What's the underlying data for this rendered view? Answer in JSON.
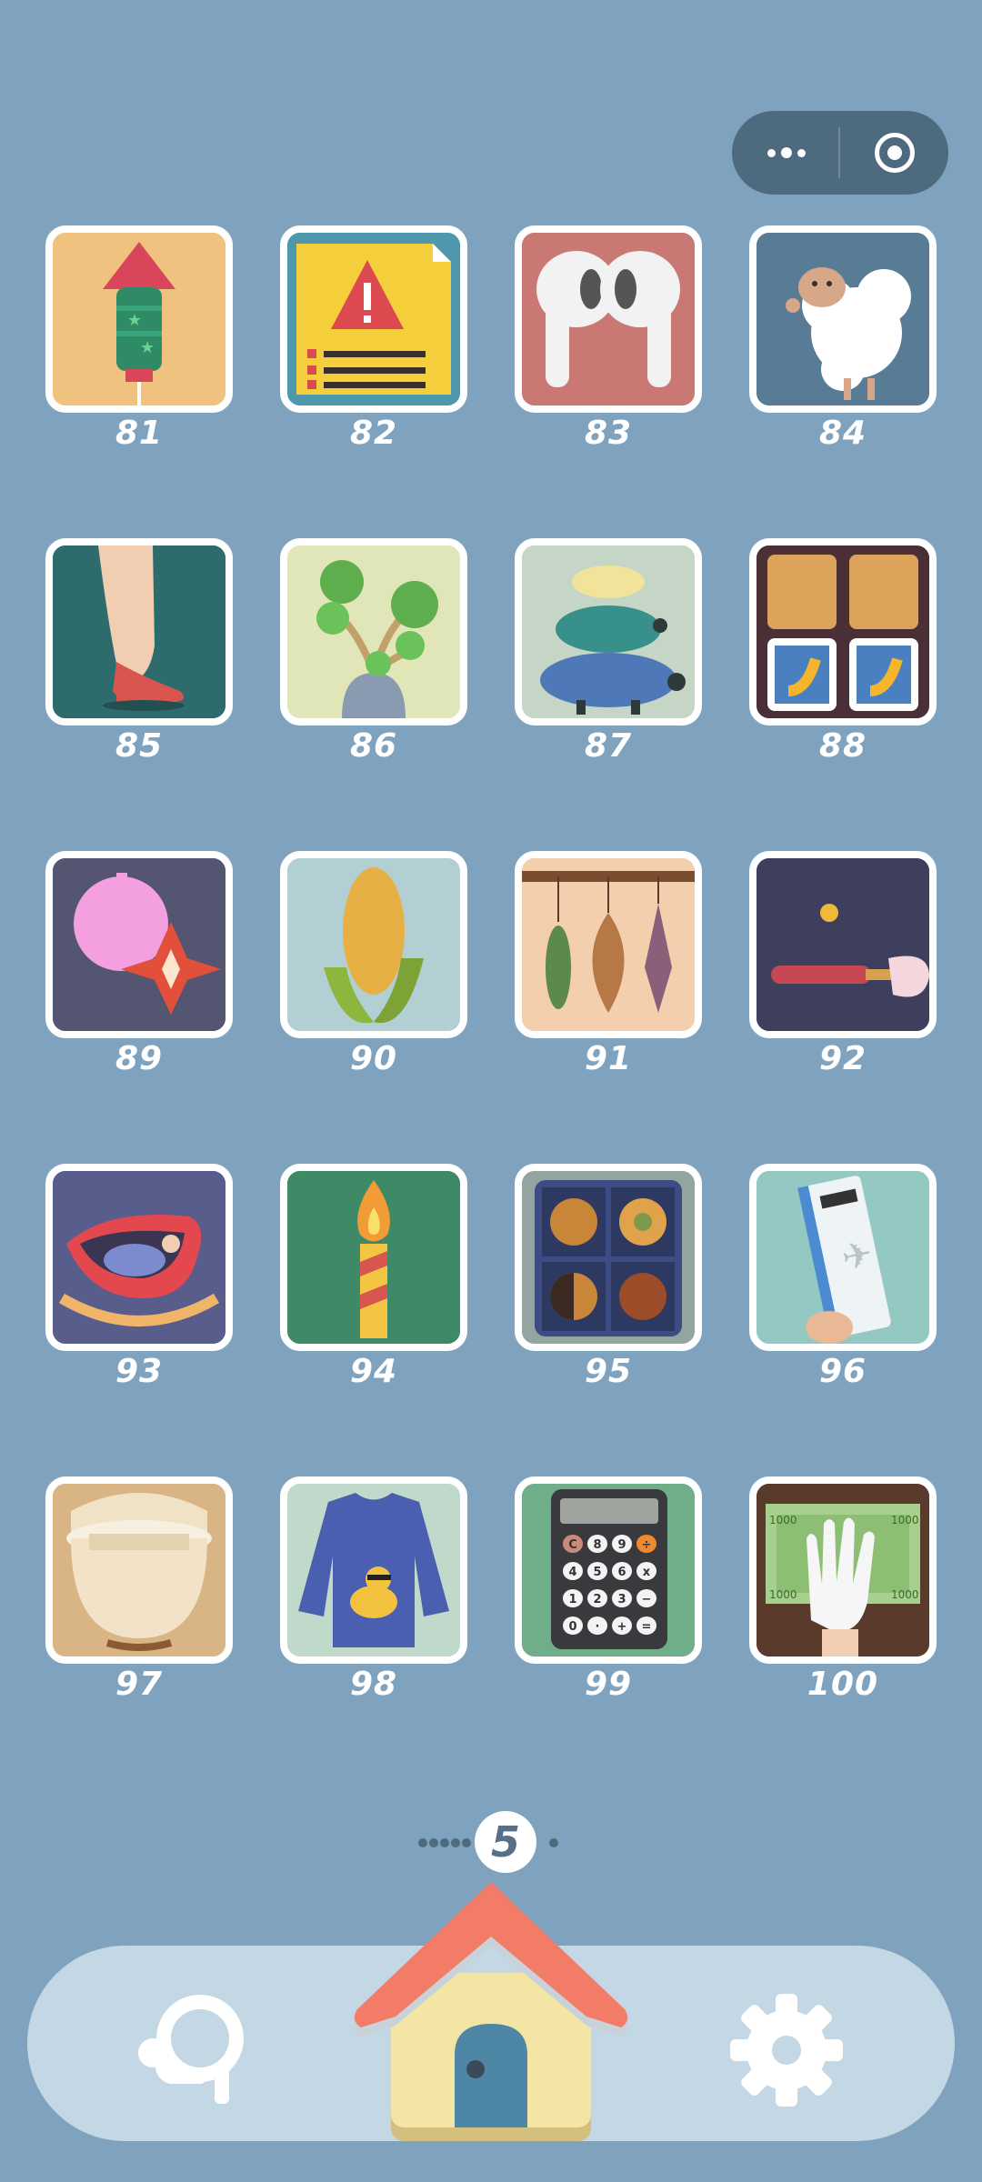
{
  "capsule": {
    "more_icon": "more-dots-icon",
    "close_icon": "target-circle-icon"
  },
  "levels": [
    {
      "number": "81",
      "icon": "firework-rocket"
    },
    {
      "number": "82",
      "icon": "warning-document"
    },
    {
      "number": "83",
      "icon": "earbuds"
    },
    {
      "number": "84",
      "icon": "sheep"
    },
    {
      "number": "85",
      "icon": "red-high-heel"
    },
    {
      "number": "86",
      "icon": "succulent-plant"
    },
    {
      "number": "87",
      "icon": "stacked-turtles"
    },
    {
      "number": "88",
      "icon": "banana-cards"
    },
    {
      "number": "89",
      "icon": "balloon-and-star"
    },
    {
      "number": "90",
      "icon": "corn"
    },
    {
      "number": "91",
      "icon": "hanging-leaves"
    },
    {
      "number": "92",
      "icon": "ping-pong-paddle"
    },
    {
      "number": "93",
      "icon": "baby-cradle"
    },
    {
      "number": "94",
      "icon": "candle"
    },
    {
      "number": "95",
      "icon": "cookie-box"
    },
    {
      "number": "96",
      "icon": "boarding-pass"
    },
    {
      "number": "97",
      "icon": "rice-pot"
    },
    {
      "number": "98",
      "icon": "duck-sweater"
    },
    {
      "number": "99",
      "icon": "calculator"
    },
    {
      "number": "100",
      "icon": "banknotes-glove"
    }
  ],
  "calculator_keys": [
    "C",
    "8",
    "9",
    "÷",
    "4",
    "5",
    "6",
    "x",
    "1",
    "2",
    "3",
    "−",
    "0",
    "·",
    "+",
    "="
  ],
  "banknote_value": "1000",
  "page_indicator": {
    "current": "5"
  },
  "bottom_nav": {
    "left_icon": "magnifier-icon",
    "center_icon": "home-icon",
    "right_icon": "gear-icon"
  },
  "colors": {
    "background": "#7fa3be",
    "bar": "#c4d7e4",
    "roof": "#f27c68",
    "house": "#f3e6a4",
    "door": "#4e87a5"
  }
}
